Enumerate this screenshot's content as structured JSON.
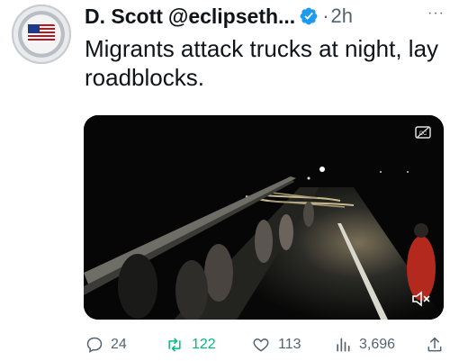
{
  "post": {
    "display_name": "D. Scott",
    "handle": "@eclipseth...",
    "separator": "·",
    "time": "2h",
    "more": "···",
    "text": "Migrants attack trucks at night, lay roadblocks.",
    "media": {
      "type": "video",
      "icons": [
        "captions-icon",
        "mute-icon"
      ]
    }
  },
  "metrics": {
    "replies": "24",
    "retweets": "122",
    "likes": "113",
    "views": "3,696"
  },
  "colors": {
    "retweet_green": "#00ba7c",
    "verified_blue": "#1d9bf0",
    "muted_gray": "#536471"
  }
}
